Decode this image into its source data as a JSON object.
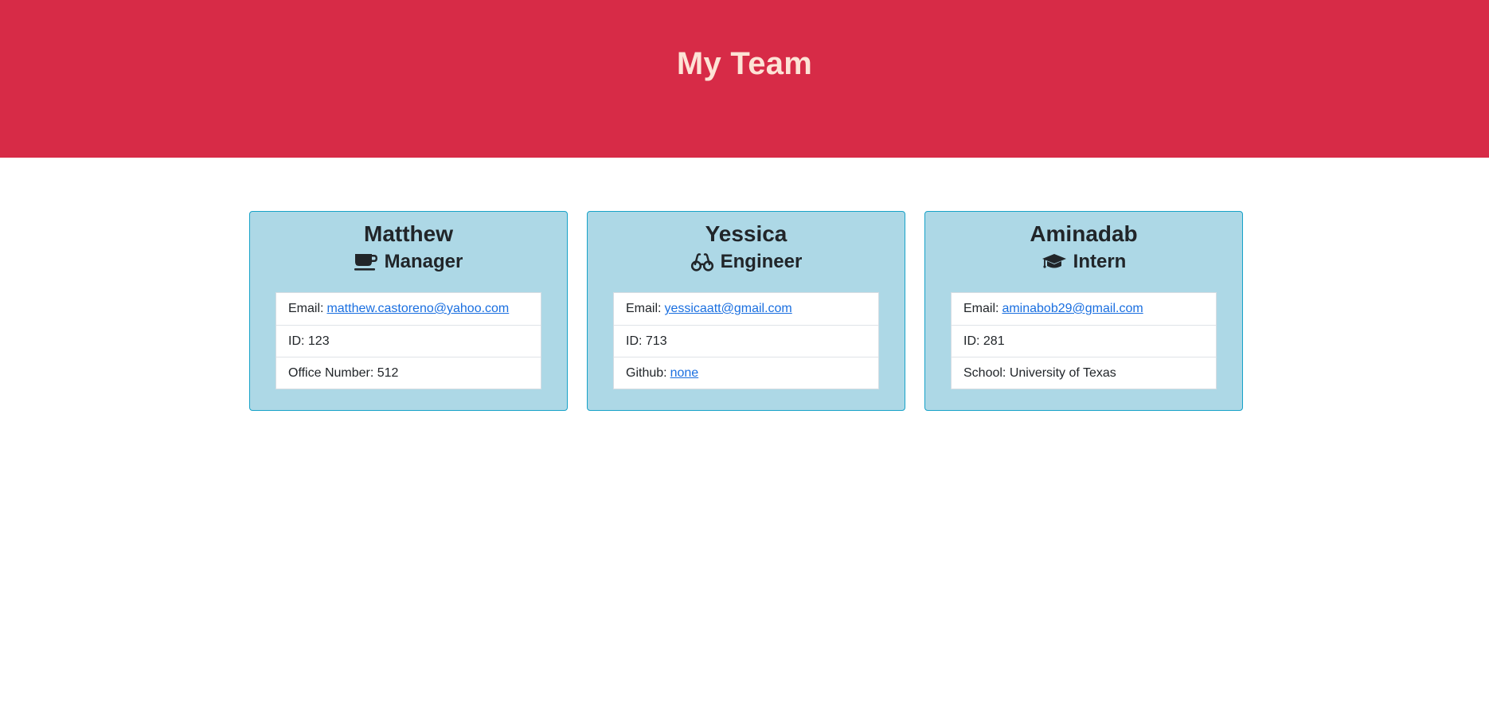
{
  "header": {
    "title": "My Team"
  },
  "colors": {
    "header_bg": "#d72b47",
    "card_bg": "#add8e6",
    "link": "#1a6fe0"
  },
  "cards": [
    {
      "name": "Matthew",
      "role": "Manager",
      "role_icon": "coffee-icon",
      "email_label": "Email:",
      "email": "matthew.castoreno@yahoo.com",
      "id_text": "ID: 123",
      "extra_label": "Office Number: 512"
    },
    {
      "name": "Yessica",
      "role": "Engineer",
      "role_icon": "glasses-icon",
      "email_label": "Email:",
      "email": "yessicaatt@gmail.com",
      "id_text": "ID: 713",
      "extra_label": "Github:",
      "extra_link": "none"
    },
    {
      "name": "Aminadab",
      "role": "Intern",
      "role_icon": "graduation-cap-icon",
      "email_label": "Email:",
      "email": "aminabob29@gmail.com",
      "id_text": "ID: 281",
      "extra_label": "School: University of Texas"
    }
  ]
}
